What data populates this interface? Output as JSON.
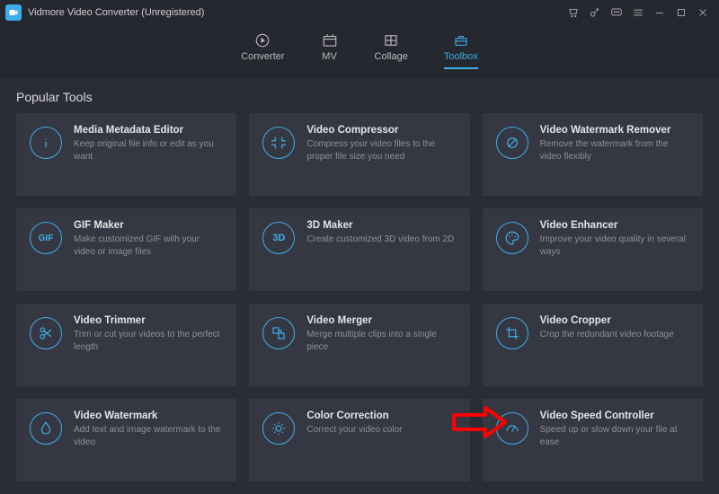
{
  "window": {
    "title": "Vidmore Video Converter (Unregistered)"
  },
  "tabs": [
    {
      "label": "Converter"
    },
    {
      "label": "MV"
    },
    {
      "label": "Collage"
    },
    {
      "label": "Toolbox"
    }
  ],
  "section_title": "Popular Tools",
  "tools": [
    {
      "title": "Media Metadata Editor",
      "desc": "Keep original file info or edit as you want"
    },
    {
      "title": "Video Compressor",
      "desc": "Compress your video files to the proper file size you need"
    },
    {
      "title": "Video Watermark Remover",
      "desc": "Remove the watermark from the video flexibly"
    },
    {
      "title": "GIF Maker",
      "desc": "Make customized GIF with your video or image files"
    },
    {
      "title": "3D Maker",
      "desc": "Create customized 3D video from 2D"
    },
    {
      "title": "Video Enhancer",
      "desc": "Improve your video quality in several ways"
    },
    {
      "title": "Video Trimmer",
      "desc": "Trim or cut your videos to the perfect length"
    },
    {
      "title": "Video Merger",
      "desc": "Merge multiple clips into a single piece"
    },
    {
      "title": "Video Cropper",
      "desc": "Crop the redundant video footage"
    },
    {
      "title": "Video Watermark",
      "desc": "Add text and image watermark to the video"
    },
    {
      "title": "Color Correction",
      "desc": "Correct your video color"
    },
    {
      "title": "Video Speed Controller",
      "desc": "Speed up or slow down your file at ease"
    }
  ]
}
